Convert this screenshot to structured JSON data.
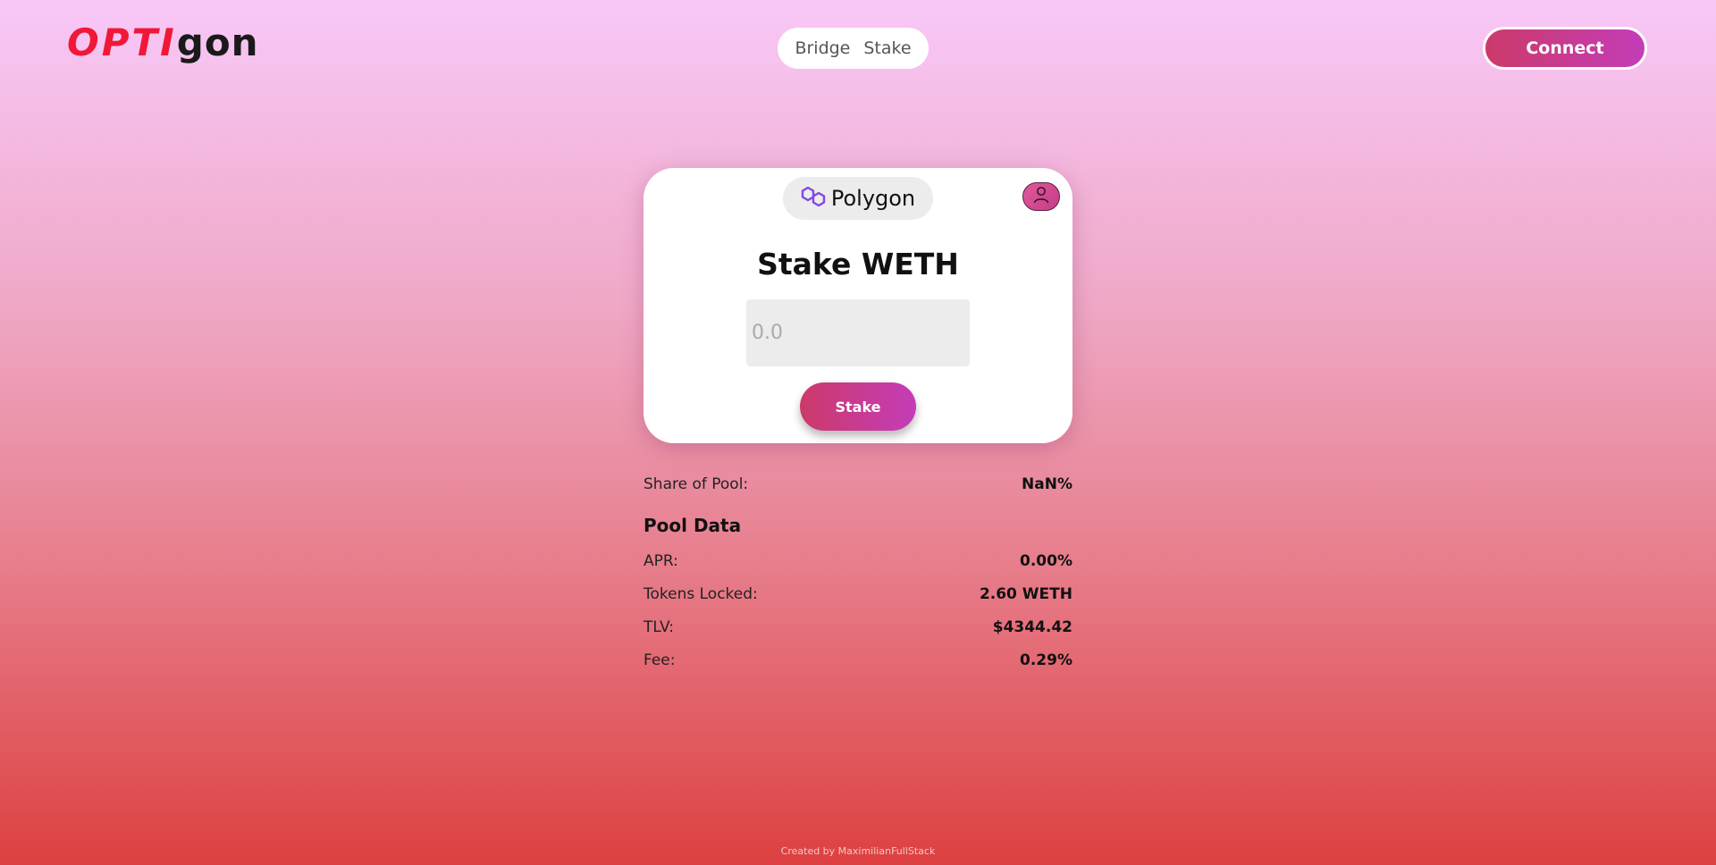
{
  "header": {
    "logo_part1": "OPTI",
    "logo_part2": "gon",
    "nav": [
      {
        "label": "Bridge"
      },
      {
        "label": "Stake"
      }
    ],
    "connect_label": "Connect"
  },
  "card": {
    "network": {
      "label": "Polygon",
      "icon": "polygon-icon"
    },
    "account_icon": "user-icon",
    "title": "Stake WETH",
    "input_placeholder": "0.0",
    "stake_label": "Stake"
  },
  "share": {
    "label": "Share of Pool:",
    "value": "NaN%"
  },
  "pool": {
    "heading": "Pool Data",
    "rows": [
      {
        "label": "APR:",
        "value": "0.00%"
      },
      {
        "label": "Tokens Locked:",
        "value": "2.60 WETH"
      },
      {
        "label": "TLV:",
        "value": "$4344.42"
      },
      {
        "label": "Fee:",
        "value": "0.29%"
      }
    ]
  },
  "footer": {
    "text": "Created by MaximilianFullStack"
  },
  "colors": {
    "accent_start": "#cc3a6a",
    "accent_end": "#c43cb8",
    "logo_red": "#f01838",
    "polygon_purple": "#8247e5"
  }
}
